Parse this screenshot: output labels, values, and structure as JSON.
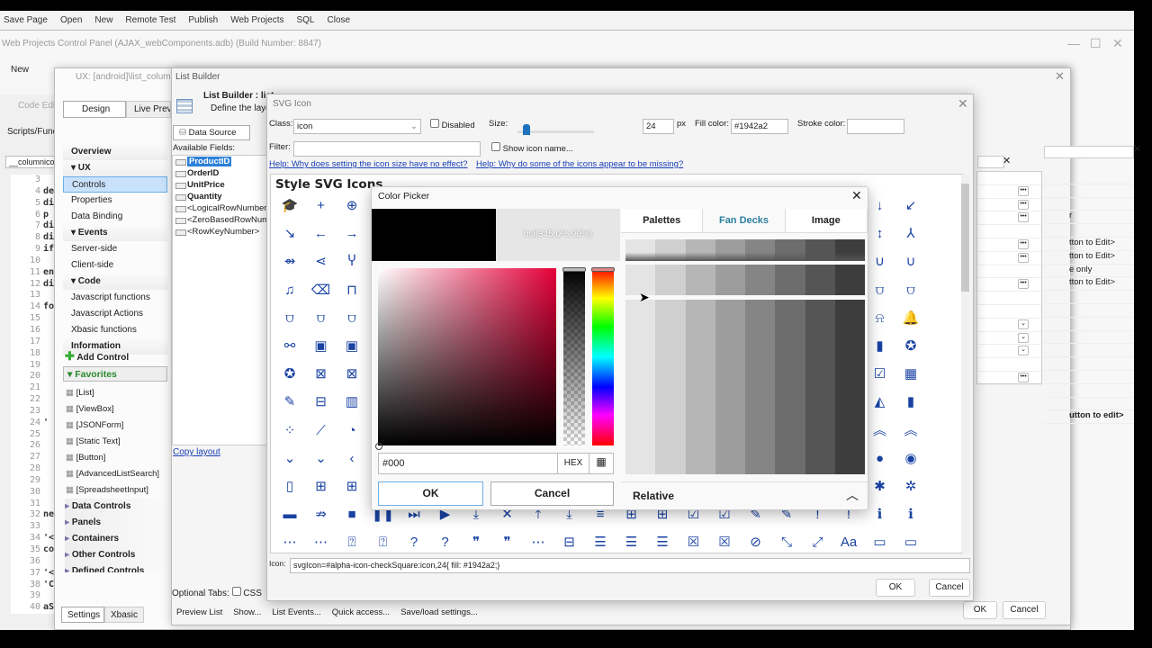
{
  "toolbar": {
    "items": [
      "Save Page",
      "Open",
      "New",
      "Remote Test",
      "Publish",
      "Web Projects",
      "SQL",
      "Close"
    ]
  },
  "window_title": "Web Projects Control Panel (AJAX_webComponents.adb) (Build Number: 8847)",
  "secondary_toolbar": {
    "new_label": "New"
  },
  "code_panel": {
    "code_edit_label": "Code Edit",
    "scripts_label": "Scripts/Funct",
    "tab": "__columnico",
    "lines": [
      [
        "3",
        ""
      ],
      [
        "4",
        "de"
      ],
      [
        "5",
        "di"
      ],
      [
        "6",
        "p"
      ],
      [
        "7",
        "di"
      ],
      [
        "8",
        "di"
      ],
      [
        "9",
        "if"
      ],
      [
        "10",
        ""
      ],
      [
        "11",
        "en"
      ],
      [
        "12",
        "di"
      ],
      [
        "13",
        ""
      ],
      [
        "14",
        "fo"
      ],
      [
        "15",
        ""
      ],
      [
        "16",
        ""
      ],
      [
        "17",
        ""
      ],
      [
        "18",
        ""
      ],
      [
        "19",
        ""
      ],
      [
        "20",
        ""
      ],
      [
        "21",
        ""
      ],
      [
        "22",
        ""
      ],
      [
        "23",
        ""
      ],
      [
        "24",
        "'"
      ],
      [
        "25",
        ""
      ],
      [
        "26",
        ""
      ],
      [
        "27",
        ""
      ],
      [
        "28",
        ""
      ],
      [
        "29",
        ""
      ],
      [
        "30",
        ""
      ],
      [
        "31",
        ""
      ],
      [
        "32",
        "ne"
      ],
      [
        "33",
        ""
      ],
      [
        "34",
        "'<"
      ],
      [
        "35",
        "co"
      ],
      [
        "36",
        ""
      ],
      [
        "37",
        "'<"
      ],
      [
        "38",
        "'C"
      ],
      [
        "39",
        ""
      ],
      [
        "40",
        "aS"
      ]
    ]
  },
  "ux_window": {
    "title": "UX: [android]\\list_columnic",
    "tabs": [
      "Design",
      "Live Previ"
    ],
    "nav": [
      {
        "label": "Overview",
        "type": "hd"
      },
      {
        "label": "▾ UX",
        "type": "hd"
      },
      {
        "label": "Controls",
        "type": "sel"
      },
      {
        "label": "Properties"
      },
      {
        "label": "Data Binding"
      },
      {
        "label": "▾ Events",
        "type": "hd"
      },
      {
        "label": "Server-side"
      },
      {
        "label": "Client-side"
      },
      {
        "label": "▾ Code",
        "type": "hd"
      },
      {
        "label": "Javascript functions"
      },
      {
        "label": "Javascript Actions"
      },
      {
        "label": "Xbasic functions"
      },
      {
        "label": "Information",
        "type": "hd"
      }
    ],
    "add_control": "Add Control",
    "favorites": "Favorites",
    "favorite_items": [
      "[List]",
      "[ViewBox]",
      "[JSONForm]",
      "[Static Text]",
      "[Button]",
      "[AdvancedListSearch]",
      "[SpreadsheetInput]"
    ],
    "groups": [
      "Data Controls",
      "Panels",
      "Containers",
      "Other Controls",
      "Defined Controls"
    ],
    "bottom_tabs": [
      "Settings",
      "Xbasic"
    ],
    "ok": "OK",
    "cancel": "Cancel"
  },
  "list_builder": {
    "title": "List Builder",
    "heading": "List Builder : list",
    "subheading": "Define the layout",
    "tab": "Data Source",
    "available_fields_label": "Available Fields:",
    "fields": [
      {
        "name": "ProductID",
        "bold": true,
        "selected": true
      },
      {
        "name": "OrderID",
        "bold": true
      },
      {
        "name": "UnitPrice",
        "bold": true
      },
      {
        "name": "Quantity",
        "bold": true
      },
      {
        "name": "<LogicalRowNumber>"
      },
      {
        "name": "<ZeroBasedRowNumber>"
      },
      {
        "name": "<RowKeyNumber>"
      }
    ],
    "copy_layout": "Copy layout",
    "optional_tabs_label": "Optional Tabs:",
    "optional_tab_css": "CSS",
    "bottom_buttons": [
      "Preview List",
      "Show...",
      "List Events...",
      "Quick access...",
      "Save/load settings..."
    ]
  },
  "right_panel": {
    "rows": [
      "",
      "",
      "",
      "r",
      "",
      "tton to Edit>",
      "tton to Edit>",
      "e only",
      "tton to Edit>",
      "",
      "",
      "",
      "",
      "",
      "",
      "",
      "",
      "",
      "utton to edit>"
    ]
  },
  "svg_dialog": {
    "title": "SVG Icon",
    "class_label": "Class:",
    "class_value": "icon",
    "disabled_label": "Disabled",
    "size_label": "Size:",
    "size_value": "24",
    "size_unit": "px",
    "size_slider_percent": 12,
    "fill_label": "Fill color:",
    "fill_value": "#1942a2",
    "stroke_label": "Stroke color:",
    "stroke_value": "",
    "filter_label": "Filter:",
    "filter_value": "",
    "show_name_label": "Show icon name...",
    "help1": "Help: Why does setting the icon size have no effect?",
    "help2": "Help: Why do some of the icons appear to be missing?",
    "grid_title": "Style SVG Icons",
    "icon_label": "Icon:",
    "icon_value": "svgIcon=#alpha-icon-checkSquare:icon,24{ fill: #1942a2;}",
    "ok": "OK",
    "cancel": "Cancel",
    "icon_color": "#1942a2"
  },
  "icon_grid": {
    "left": [
      [
        "graduation-cap",
        "plus",
        "plus-circle"
      ],
      [
        "arrow-down-right",
        "arrow-left",
        "arrow-right"
      ],
      [
        "merge",
        "split",
        "fork"
      ],
      [
        "music-note",
        "backspace",
        "shopping-bag"
      ],
      [
        "basket-plus",
        "basket-check",
        "basket-check"
      ],
      [
        "binoculars",
        "book",
        "book-plus"
      ],
      [
        "bookmark-star",
        "bookmark-x",
        "bookmark-x"
      ],
      [
        "calendar-edit",
        "calendar-minus",
        "calendar-grid"
      ],
      [
        "chart-scatter",
        "chart-line",
        "chart-pie"
      ],
      [
        "chevron-down",
        "chevron-down",
        "chevron-left"
      ],
      [
        "clipboard",
        "clipboard-plus",
        "clipboard-plus"
      ]
    ],
    "right": [
      [
        "arrow-down",
        "arrow-down-left"
      ],
      [
        "arrow-up-down",
        "split-down"
      ],
      [
        "u-turn",
        "u-turn"
      ],
      [
        "basket",
        "basket-plus"
      ],
      [
        "bell-off",
        "bell-ring"
      ],
      [
        "bookmark",
        "bookmark-star"
      ],
      [
        "calendar-check",
        "calendar-day"
      ],
      [
        "chart-area",
        "chart-bar"
      ],
      [
        "chevron-double-up",
        "chevron-double-up"
      ],
      [
        "circle",
        "radio"
      ],
      [
        "bug",
        "bug-off"
      ]
    ],
    "row11": [
      "battery",
      "tag",
      "square",
      "pause",
      "skip-next",
      "play",
      "download",
      "close",
      "upload",
      "download",
      "align",
      "plus-box",
      "plus-box",
      "check-box",
      "check-box",
      "edit",
      "edit",
      "alert",
      "alert",
      "info",
      "info"
    ],
    "row12": [
      "comment",
      "comment",
      "account-box",
      "account-box",
      "help-box",
      "help-box",
      "quote",
      "quote",
      "comment",
      "minus-box",
      "text-box",
      "text-box",
      "text-box",
      "close-box",
      "close-box",
      "compass",
      "collapse",
      "expand",
      "text-field",
      "card",
      "card"
    ]
  },
  "color_picker": {
    "title": "Color Picker",
    "preview_text": "hsl(345,0%,90%)",
    "current_color": "#000000",
    "hue": 345,
    "hex_value": "#000",
    "format_label": "HEX",
    "ok": "OK",
    "cancel": "Cancel",
    "tabs": [
      "Palettes",
      "Fan Decks",
      "Image"
    ],
    "active_tab": "Fan Decks",
    "relative_label": "Relative",
    "fan_deck_shades": [
      "#e4e4e4",
      "#cfcfcf",
      "#b6b6b6",
      "#9d9d9d",
      "#858585",
      "#6d6d6d",
      "#555555",
      "#3d3d3d"
    ]
  }
}
